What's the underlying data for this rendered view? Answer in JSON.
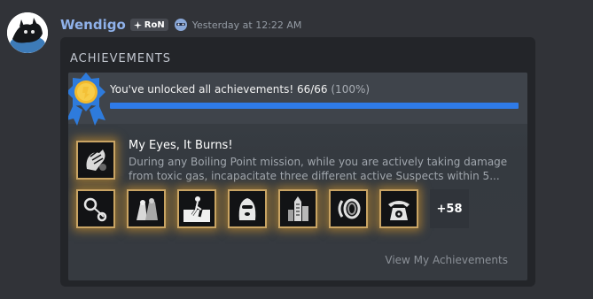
{
  "message": {
    "username": "Wendigo",
    "server_tag": "RoN",
    "timestamp": "Yesterday at 12:22 AM"
  },
  "embed": {
    "title": "ACHIEVEMENTS",
    "summary": {
      "text": "You've unlocked all achievements! 66/66",
      "percent_text": "(100%)",
      "progress_fraction": 1.0
    },
    "featured": {
      "name": "My Eyes, It Burns!",
      "description": "During any Boiling Point mission, while you are actively taking damage from toxic gas, incapacitate three different active Suspects within 5..."
    },
    "more_count": "+58",
    "view_link": "View My Achievements"
  },
  "colors": {
    "username": "#8fb1ea",
    "progress": "#2f7be8",
    "tile_glow": "#e6a028"
  },
  "icons": [
    "avatar-icon",
    "gamepad-icon",
    "mask-icon",
    "medal-icon",
    "gas-hand-icon",
    "handcuffs-icon",
    "ghost-figures-icon",
    "swimmer-icon",
    "balaclava-icon",
    "tower-icon",
    "spiral-icon",
    "telephone-icon"
  ]
}
